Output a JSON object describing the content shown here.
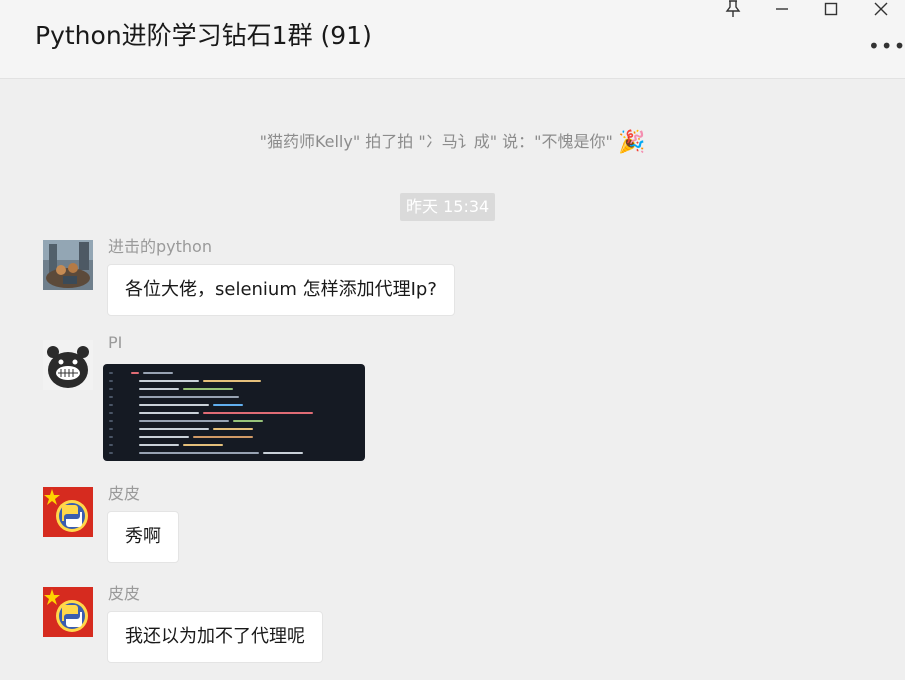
{
  "window": {
    "title": "Python进阶学习钻石1群 (91)",
    "pin_icon": "pin-icon",
    "minimize_icon": "minimize-icon",
    "maximize_icon": "maximize-icon",
    "close_icon": "close-icon",
    "more_icon": "more-options-icon"
  },
  "system_message": {
    "text": "\"猫药师Kelly\" 拍了拍 \"冫马讠成\" 说：\"不愧是你\"",
    "emoji": "🎉"
  },
  "timestamp": "昨天 15:34",
  "messages": [
    {
      "sender": "进击的python",
      "text": "各位大佬，selenium 怎样添加代理Ip?"
    },
    {
      "sender": "PI",
      "image": "code-screenshot"
    },
    {
      "sender": "皮皮",
      "text": "秀啊"
    },
    {
      "sender": "皮皮",
      "text": "我还以为加不了代理呢"
    }
  ],
  "colors": {
    "background": "#efefef",
    "bubble": "#ffffff",
    "code_bg": "#151a23"
  }
}
